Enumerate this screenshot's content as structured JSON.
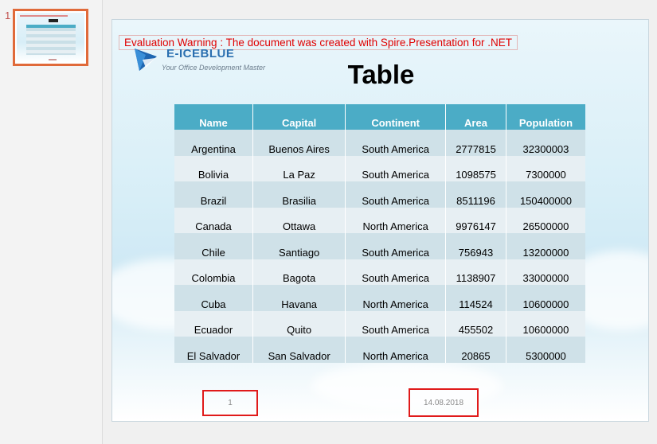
{
  "thumbnails": [
    {
      "number": "1"
    }
  ],
  "slide": {
    "warning": "Evaluation Warning : The document was created with  Spire.Presentation for .NET",
    "logo": {
      "name": "E-ICEBLUE",
      "tagline": "Your Office Development Master"
    },
    "title": "Table",
    "table": {
      "headers": [
        "Name",
        "Capital",
        "Continent",
        "Area",
        "Population"
      ],
      "rows": [
        [
          "Argentina",
          "Buenos Aires",
          "South America",
          "2777815",
          "32300003"
        ],
        [
          "Bolivia",
          "La Paz",
          "South America",
          "1098575",
          "7300000"
        ],
        [
          "Brazil",
          "Brasilia",
          "South America",
          "8511196",
          "150400000"
        ],
        [
          "Canada",
          "Ottawa",
          "North America",
          "9976147",
          "26500000"
        ],
        [
          "Chile",
          "Santiago",
          "South America",
          "756943",
          "13200000"
        ],
        [
          "Colombia",
          "Bagota",
          "South America",
          "1138907",
          "33000000"
        ],
        [
          "Cuba",
          "Havana",
          "North America",
          "114524",
          "10600000"
        ],
        [
          "Ecuador",
          "Quito",
          "South America",
          "455502",
          "10600000"
        ],
        [
          "El Salvador",
          "San Salvador",
          "North America",
          "20865",
          "5300000"
        ]
      ]
    },
    "footer": {
      "slide_number": "1",
      "date": "14.08.2018"
    }
  },
  "colors": {
    "table_header": "#4bacc6",
    "warning_text": "#e00000",
    "highlight_box": "#e01a1a",
    "thumb_selected": "#e06a3a"
  }
}
